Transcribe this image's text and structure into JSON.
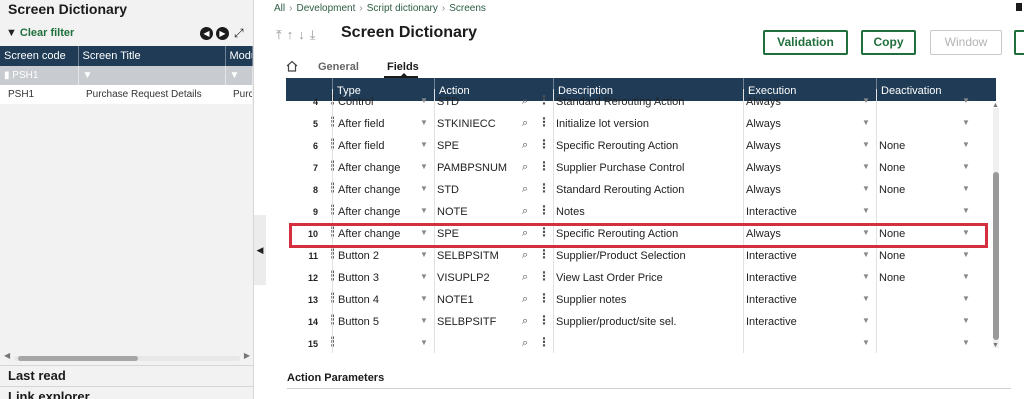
{
  "left_panel": {
    "title": "Screen Dictionary",
    "clear_filter": "Clear filter",
    "table": {
      "columns": [
        "Screen code",
        "Screen Title",
        "Modu"
      ],
      "filter_row": [
        "PSH1",
        "",
        ""
      ],
      "rows": [
        [
          "PSH1",
          "Purchase Request Details",
          "Purc"
        ]
      ]
    },
    "sections": [
      "Last read",
      "Link explorer"
    ]
  },
  "breadcrumb": [
    "All",
    "Development",
    "Script dictionary",
    "Screens"
  ],
  "main": {
    "title": "Screen Dictionary",
    "buttons": {
      "validation": "Validation",
      "copy": "Copy",
      "window": "Window"
    },
    "tabs": {
      "general": "General",
      "fields": "Fields"
    },
    "grid": {
      "columns": [
        "Type",
        "Action",
        "Description",
        "Execution",
        "Deactivation"
      ],
      "partial_row": {
        "num": "4",
        "type": "Control",
        "action": "STD",
        "description": "Standard Rerouting Action",
        "execution": "Always",
        "deactivation": ""
      },
      "rows": [
        {
          "num": "5",
          "type": "After field",
          "action": "STKINIECC",
          "description": "Initialize lot version",
          "execution": "Always",
          "deactivation": ""
        },
        {
          "num": "6",
          "type": "After field",
          "action": "SPE",
          "description": "Specific Rerouting Action",
          "execution": "Always",
          "deactivation": "None"
        },
        {
          "num": "7",
          "type": "After change",
          "action": "PAMBPSNUM",
          "description": "Supplier Purchase Control",
          "execution": "Always",
          "deactivation": "None"
        },
        {
          "num": "8",
          "type": "After change",
          "action": "STD",
          "description": "Standard Rerouting Action",
          "execution": "Always",
          "deactivation": "None"
        },
        {
          "num": "9",
          "type": "After change",
          "action": "NOTE",
          "description": "Notes",
          "execution": "Interactive",
          "deactivation": ""
        },
        {
          "num": "10",
          "type": "After change",
          "action": "SPE",
          "description": "Specific Rerouting Action",
          "execution": "Always",
          "deactivation": "None"
        },
        {
          "num": "11",
          "type": "Button 2",
          "action": "SELBPSITM",
          "description": "Supplier/Product Selection",
          "execution": "Interactive",
          "deactivation": "None"
        },
        {
          "num": "12",
          "type": "Button 3",
          "action": "VISUPLP2",
          "description": "View Last Order Price",
          "execution": "Interactive",
          "deactivation": "None"
        },
        {
          "num": "13",
          "type": "Button 4",
          "action": "NOTE1",
          "description": "Supplier notes",
          "execution": "Interactive",
          "deactivation": ""
        },
        {
          "num": "14",
          "type": "Button 5",
          "action": "SELBPSITF",
          "description": "Supplier/product/site sel.",
          "execution": "Interactive",
          "deactivation": ""
        },
        {
          "num": "15",
          "type": "",
          "action": "",
          "description": "",
          "execution": "",
          "deactivation": ""
        }
      ]
    },
    "params_title": "Action Parameters"
  },
  "colors": {
    "header_bg": "#1f3b56",
    "accent_green": "#1f6f3c",
    "highlight": "#d32f3f"
  }
}
